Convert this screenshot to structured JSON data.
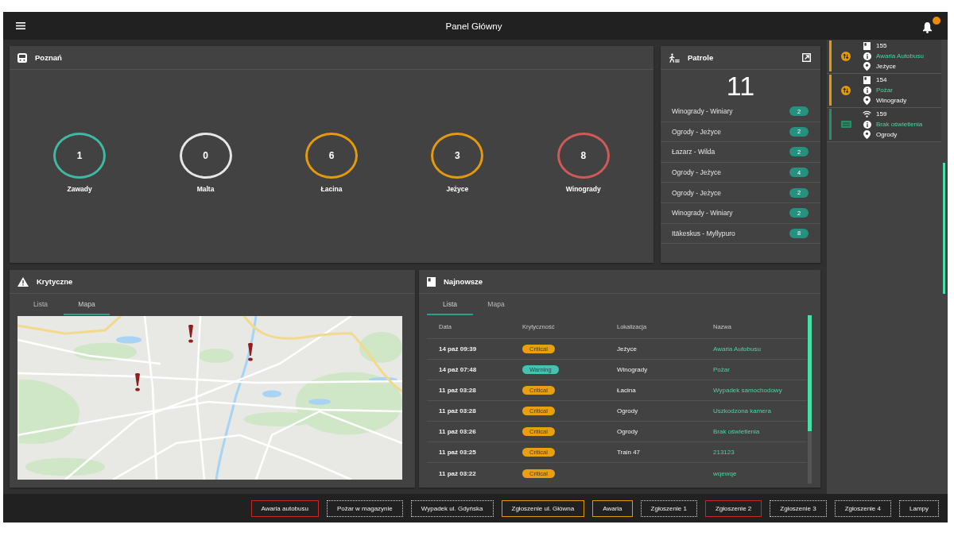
{
  "app_bar": {
    "title": "Panel Główny"
  },
  "district_panel": {
    "title": "Poznań",
    "districts": [
      {
        "name": "Zawady",
        "count": "1",
        "color": "#3fb8a4"
      },
      {
        "name": "Malta",
        "count": "0",
        "color": "#e6e6e6"
      },
      {
        "name": "Łacina",
        "count": "6",
        "color": "#e39b0b"
      },
      {
        "name": "Jeżyce",
        "count": "3",
        "color": "#e39b0b"
      },
      {
        "name": "Winogrady",
        "count": "8",
        "color": "#d05a58"
      }
    ]
  },
  "patrols_panel": {
    "title": "Patrole",
    "total": "11",
    "routes": [
      {
        "name": "Winogrady - Winiary",
        "count": "2"
      },
      {
        "name": "Ogrody - Jeżyce",
        "count": "2"
      },
      {
        "name": "Łazarz - Wilda",
        "count": "2"
      },
      {
        "name": "Ogrody - Jeżyce",
        "count": "4"
      },
      {
        "name": "Ogrody - Jeżyce",
        "count": "2"
      },
      {
        "name": "Winogrady - Winiary",
        "count": "2"
      },
      {
        "name": "Itäkeskus - Myllypuro",
        "count": "8"
      }
    ]
  },
  "critical_panel": {
    "title": "Krytyczne",
    "tabs": [
      {
        "label": "Lista",
        "selected": false
      },
      {
        "label": "Mapa",
        "selected": true
      }
    ]
  },
  "latest_panel": {
    "title": "Najnowsze",
    "tabs": [
      {
        "label": "Lista",
        "selected": true
      },
      {
        "label": "Mapa",
        "selected": false
      }
    ],
    "table": {
      "columns": [
        "Data",
        "Krytyczność",
        "Lokalizacja",
        "Nazwa"
      ],
      "rows": [
        {
          "date": "14 paź 09:39",
          "severity": {
            "label": "Critical",
            "color": "#e8a010"
          },
          "location": "Jeżyce",
          "name": "Awaria Autobusu"
        },
        {
          "date": "14 paź 07:48",
          "severity": {
            "label": "Warning",
            "color": "#45c2b0"
          },
          "location": "Winogrady",
          "name": "Pożar"
        },
        {
          "date": "11 paź 03:28",
          "severity": {
            "label": "Critical",
            "color": "#e8a010"
          },
          "location": "Łacina",
          "name": "Wypadek samochodowy"
        },
        {
          "date": "11 paź 03:28",
          "severity": {
            "label": "Critical",
            "color": "#e8a010"
          },
          "location": "Ogrody",
          "name": "Uszkodzona kamera"
        },
        {
          "date": "11 paź 03:26",
          "severity": {
            "label": "Critical",
            "color": "#e8a010"
          },
          "location": "Ogrody",
          "name": "Brak oświetlenia"
        },
        {
          "date": "11 paź 03:25",
          "severity": {
            "label": "Critical",
            "color": "#e8a010"
          },
          "location": "Train 47",
          "name": "213123"
        },
        {
          "date": "11 paź 03:22",
          "severity": {
            "label": "Critical",
            "color": "#e8a010"
          },
          "name": "wqewqe"
        }
      ]
    }
  },
  "incident_feed": [
    {
      "kind": "report",
      "number": "155",
      "title": "Awaria Autobusu",
      "location": "Jeżyce",
      "color": "#e39b0b"
    },
    {
      "kind": "report",
      "number": "154",
      "title": "Pożar",
      "location": "Winogrady",
      "color": "#e39b0b"
    },
    {
      "kind": "sensor",
      "number": "159",
      "title": "Brak oświetlenia",
      "location": "Ogrody",
      "color": "#2e8b65"
    }
  ],
  "quick_filters": [
    {
      "label": "Awaria autobusu",
      "kind": "critical"
    },
    {
      "label": "Pożar w magazynie",
      "kind": "plain"
    },
    {
      "label": "Wypadek ul. Gdyńska",
      "kind": "plain"
    },
    {
      "label": "Zgłoszenie ul. Główna",
      "kind": "warning"
    },
    {
      "label": "Awaria",
      "kind": "warning"
    },
    {
      "label": "Zgłoszenie 1",
      "kind": "plain"
    },
    {
      "label": "Zgłoszenie 2",
      "kind": "critical"
    },
    {
      "label": "Zgłoszenie 3",
      "kind": "plain"
    },
    {
      "label": "Zgłoszenie 4",
      "kind": "plain"
    },
    {
      "label": "Lampy",
      "kind": "plain"
    }
  ]
}
